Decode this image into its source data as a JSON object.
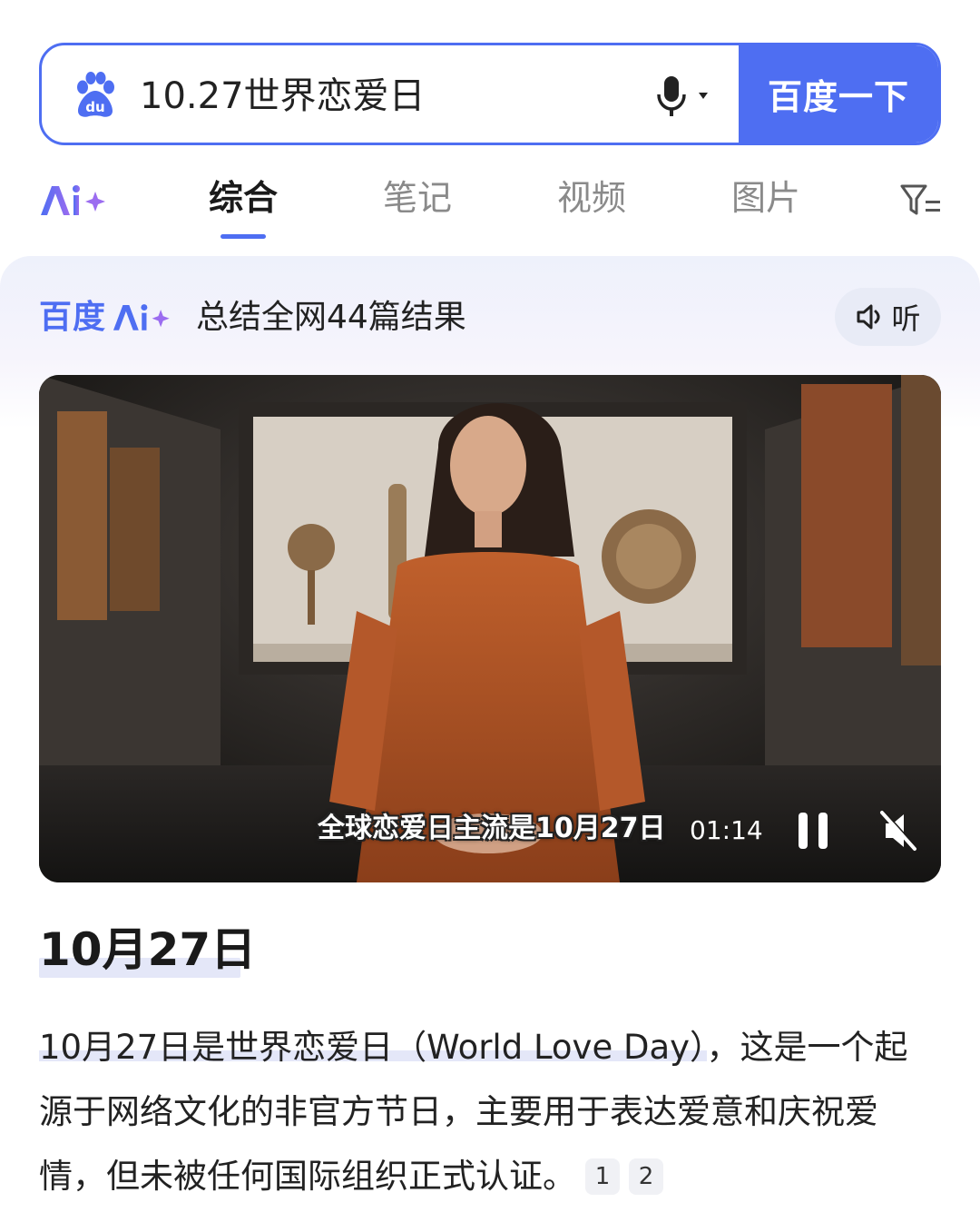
{
  "search": {
    "query": "10.27世界恋爱日",
    "button_label": "百度一下"
  },
  "tabs": {
    "ai_icon": "ai-plus-icon",
    "items": [
      "综合",
      "笔记",
      "视频",
      "图片"
    ],
    "active": "综合"
  },
  "ai_card": {
    "brand": "百度",
    "summary": "总结全网44篇结果",
    "listen_label": "听"
  },
  "video": {
    "subtitle": "全球恋爱日主流是10月27日",
    "time": "01:14",
    "state": "playing",
    "muted": true
  },
  "answer": {
    "title": "10月27日",
    "highlight": "10月27日是世界恋爱日（World Love Day）",
    "rest": "，这是一个起源于网络文化的非官方节日，主要用于表达爱意和庆祝爱情，但未被任何国际组织正式认证。",
    "refs": [
      "1",
      "2"
    ]
  },
  "colors": {
    "brand_blue": "#4e6ef2",
    "ai_purple": "#9b6cf0"
  }
}
